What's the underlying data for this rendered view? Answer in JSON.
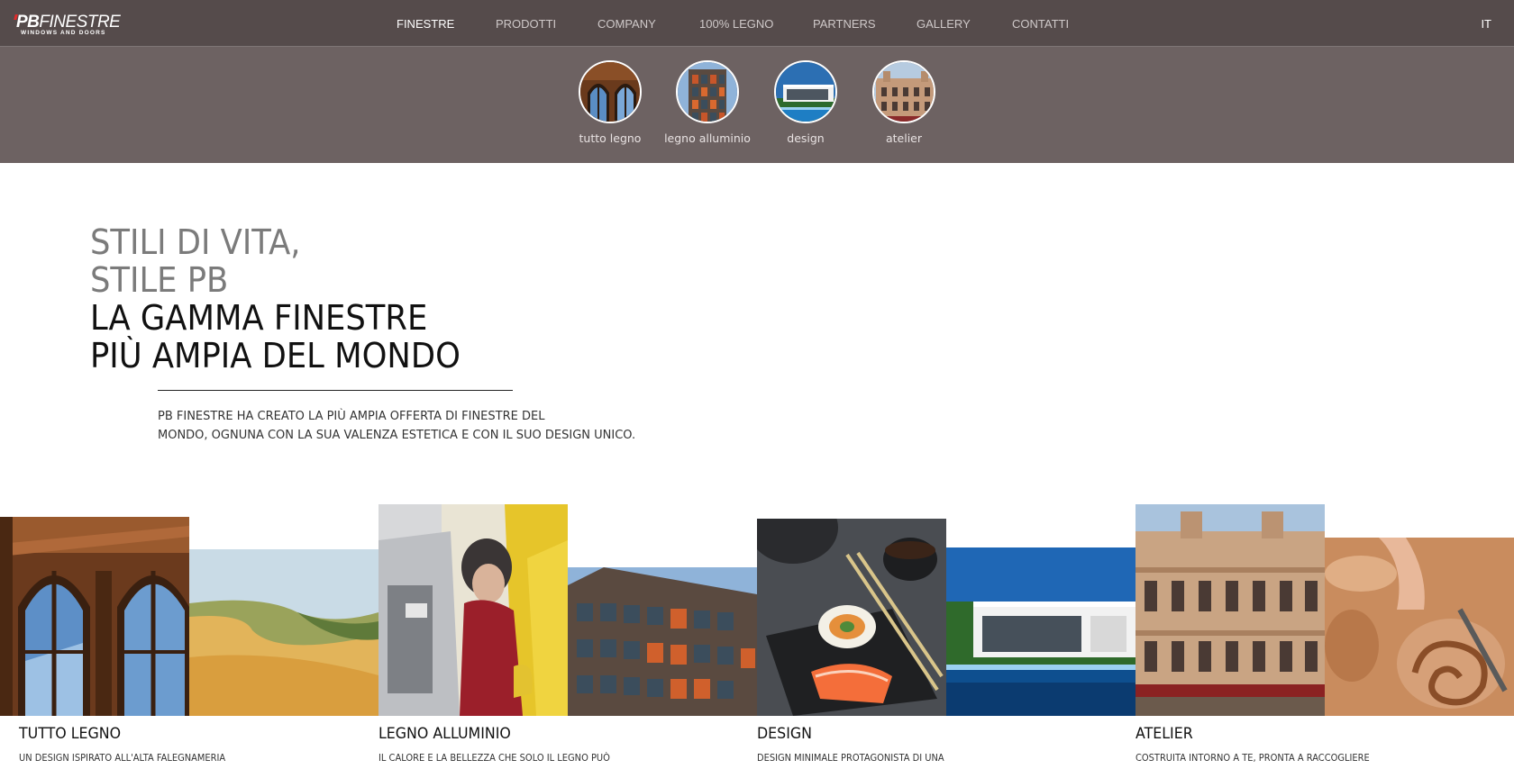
{
  "header": {
    "logo_text": "PB FINESTRE",
    "logo_tagline": "WINDOWS AND DOORS",
    "nav": [
      {
        "label": "FINESTRE",
        "active": true
      },
      {
        "label": "PRODOTTI",
        "active": false
      },
      {
        "label": "COMPANY",
        "active": false
      },
      {
        "label": "100% LEGNO",
        "active": false
      },
      {
        "label": "PARTNERS",
        "active": false
      },
      {
        "label": "GALLERY",
        "active": false
      },
      {
        "label": "CONTATTI",
        "active": false
      }
    ],
    "lang": "IT"
  },
  "categories": [
    {
      "label": "tutto legno"
    },
    {
      "label": "legno alluminio"
    },
    {
      "label": "design"
    },
    {
      "label": "atelier"
    }
  ],
  "hero": {
    "line1": "STILI DI VITA,",
    "line2": "STILE PB",
    "line3": "LA GAMMA FINESTRE",
    "line4": "PIÙ AMPIA DEL MONDO",
    "intro_line1": "PB FINESTRE HA CREATO LA PIÙ AMPIA OFFERTA DI FINESTRE DEL",
    "intro_line2": "MONDO, OGNUNA CON LA SUA VALENZA ESTETICA E CON IL SUO DESIGN UNICO."
  },
  "sections": [
    {
      "title": "TUTTO LEGNO",
      "text": "UN DESIGN ISPIRATO ALL'ALTA FALEGNAMERIA"
    },
    {
      "title": "LEGNO ALLUMINIO",
      "text": "IL CALORE E LA BELLEZZA CHE SOLO IL LEGNO PUÒ"
    },
    {
      "title": "DESIGN",
      "text": "DESIGN MINIMALE PROTAGONISTA DI UNA"
    },
    {
      "title": "ATELIER",
      "text": "COSTRUITA INTORNO A TE, PRONTA A RACCOGLIERE"
    }
  ],
  "colors": {
    "topbar": "#554b4b",
    "subbar": "#6d6262",
    "nav_text": "#cfc9c9",
    "heading_gray": "#7b7b7b",
    "heading_dark": "#111111"
  }
}
